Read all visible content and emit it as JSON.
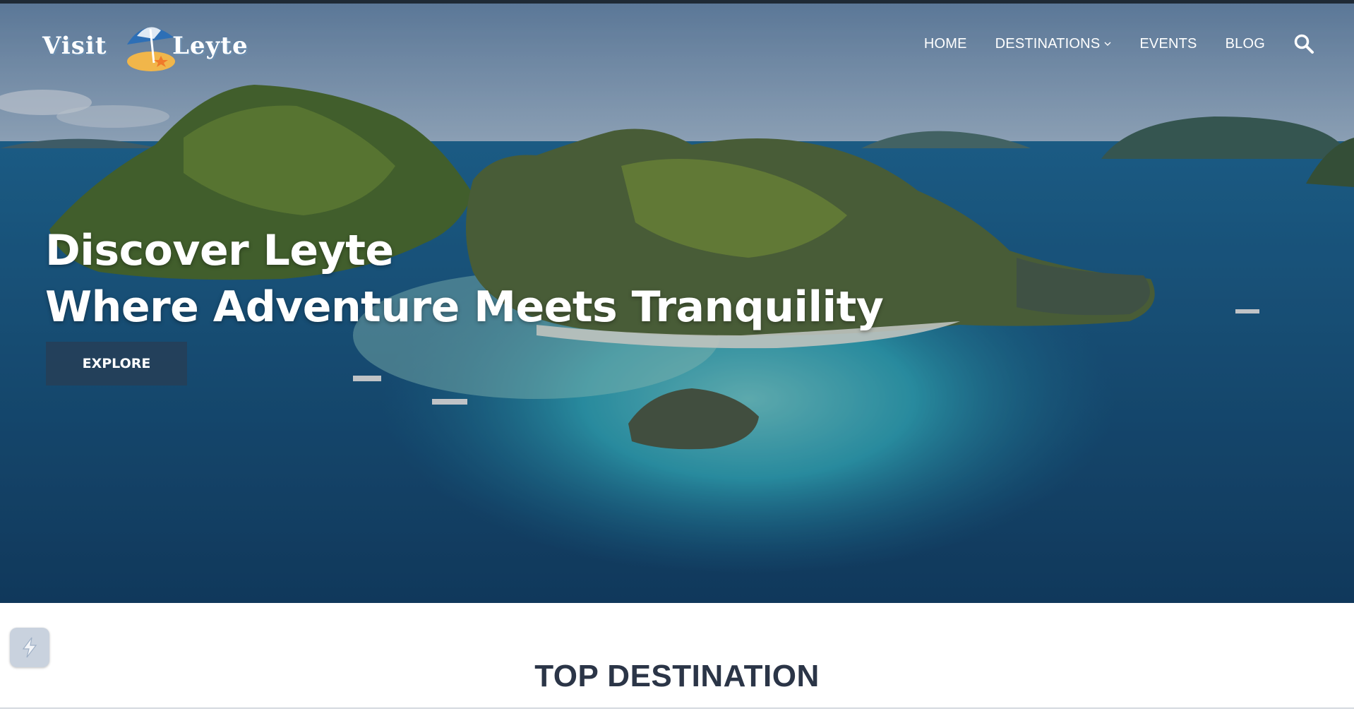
{
  "brand": {
    "logo_left": "Visit",
    "logo_right": "Leyte"
  },
  "nav": {
    "items": [
      {
        "label": "HOME"
      },
      {
        "label": "DESTINATIONS",
        "has_dropdown": true
      },
      {
        "label": "EVENTS"
      },
      {
        "label": "BLOG"
      }
    ],
    "search_icon": "search-icon"
  },
  "hero": {
    "title_line1": "Discover Leyte",
    "title_line2": "Where Adventure Meets Tranquility",
    "cta_label": "EXPLORE"
  },
  "section": {
    "title": "TOP DESTINATION"
  },
  "floating_button_icon": "lightning-icon",
  "colors": {
    "overlay_button": "#283e54",
    "section_title": "#2b3547",
    "fab_bg": "#c9d2de"
  }
}
